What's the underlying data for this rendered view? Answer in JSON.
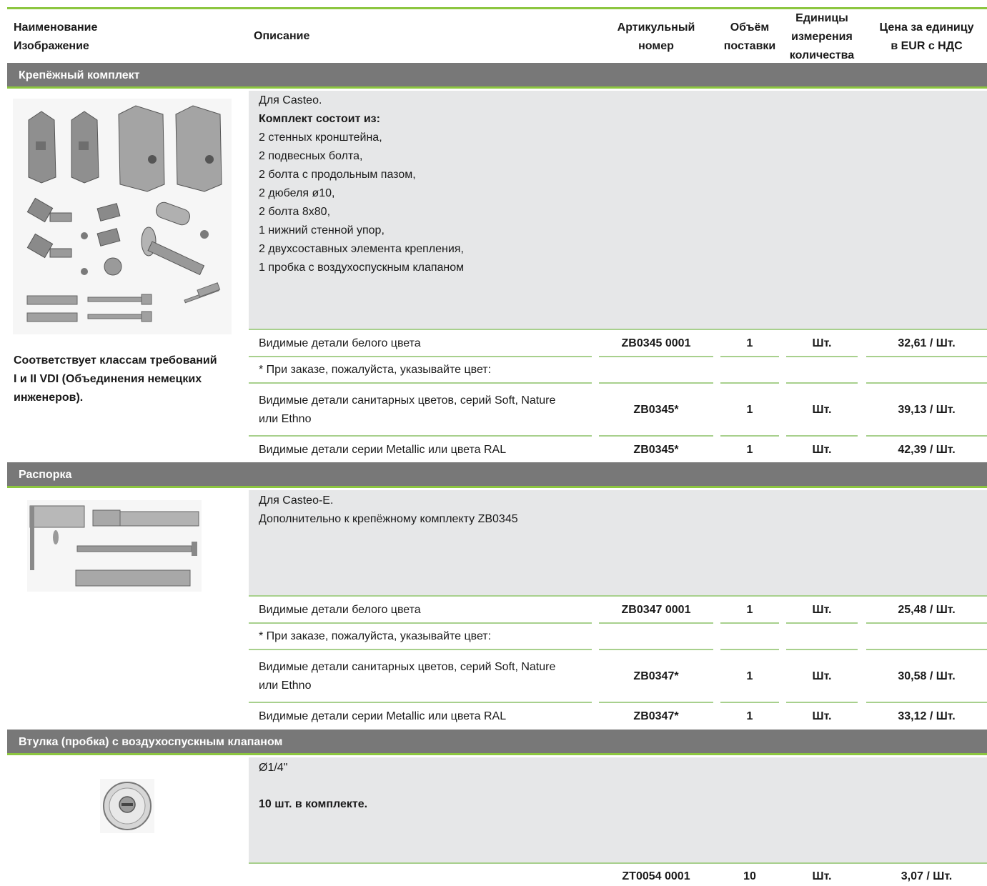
{
  "header": {
    "col1_line1": "Наименование",
    "col1_line2": "Изображение",
    "col2": "Описание",
    "col3_line1": "Артикульный",
    "col3_line2": "номер",
    "col4_line1": "Объём",
    "col4_line2": "поставки",
    "col5_line1": "Единицы",
    "col5_line2": "измерения",
    "col5_line3": "количества",
    "col6_line1": "Цена за единицу",
    "col6_line2": "в EUR с НДС"
  },
  "sections": [
    {
      "title": "Крепёжный комплект",
      "desc_lines": [
        "Для Casteo.",
        "Комплект состоит из:",
        "2 стенных кронштейна,",
        "2 подвесных болта,",
        "2 болта с продольным пазом,",
        "2 дюбеля ø10,",
        "2 болта 8x80,",
        "1 нижний стенной упор,",
        "2 двухсоставных элемента крепления,",
        "1 пробка с воздухоспускным клапаном"
      ],
      "note_line1": "Соответствует классам требований",
      "note_line2": "I и II VDI (Объединения немецких",
      "note_line3": "инженеров).",
      "rows": [
        {
          "desc": "Видимые детали белого цвета",
          "article": "ZB0345 0001",
          "qty": "1",
          "unit": "Шт.",
          "price": "32,61 / Шт."
        },
        {
          "desc": "* При заказе, пожалуйста, указывайте цвет:",
          "article": "",
          "qty": "",
          "unit": "",
          "price": ""
        },
        {
          "desc1": "Видимые детали санитарных цветов, серий Soft, Nature",
          "desc2": "или Ethno",
          "article": "ZB0345*",
          "qty": "1",
          "unit": "Шт.",
          "price": "39,13 / Шт."
        },
        {
          "desc": "Видимые детали серии Metallic или цвета RAL",
          "article": "ZB0345*",
          "qty": "1",
          "unit": "Шт.",
          "price": "42,39 / Шт."
        }
      ]
    },
    {
      "title": "Распорка",
      "desc_lines": [
        "Для Casteo-E.",
        "Дополнительно к крепёжному комплекту ZB0345"
      ],
      "rows": [
        {
          "desc": "Видимые детали белого цвета",
          "article": "ZB0347 0001",
          "qty": "1",
          "unit": "Шт.",
          "price": "25,48 / Шт."
        },
        {
          "desc": "* При заказе, пожалуйста, указывайте цвет:",
          "article": "",
          "qty": "",
          "unit": "",
          "price": ""
        },
        {
          "desc1": "Видимые детали санитарных цветов, серий Soft, Nature",
          "desc2": "или Ethno",
          "article": "ZB0347*",
          "qty": "1",
          "unit": "Шт.",
          "price": "30,58 / Шт."
        },
        {
          "desc": "Видимые детали серии Metallic или цвета RAL",
          "article": "ZB0347*",
          "qty": "1",
          "unit": "Шт.",
          "price": "33,12 / Шт."
        }
      ]
    },
    {
      "title": "Втулка (пробка) с воздухоспускным клапаном",
      "desc_line1": "Ø1/4\"",
      "desc_line2": "10 шт. в комплекте.",
      "rows": [
        {
          "desc": "",
          "article": "ZT0054 0001",
          "qty": "10",
          "unit": "Шт.",
          "price": "3,07 / Шт."
        }
      ]
    }
  ],
  "colors": {
    "accent": "#8cc63f",
    "band": "#787878",
    "block": "#e6e7e8"
  }
}
